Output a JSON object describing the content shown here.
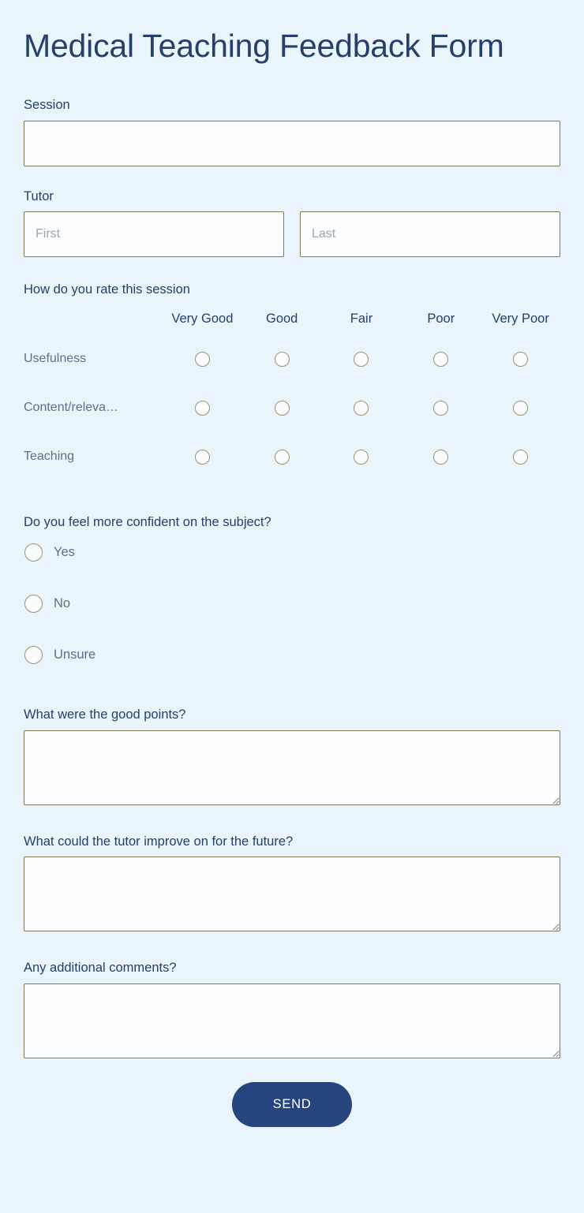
{
  "form": {
    "title": "Medical Teaching Feedback Form"
  },
  "session": {
    "label": "Session",
    "value": "",
    "placeholder": ""
  },
  "tutor": {
    "label": "Tutor",
    "first": {
      "value": "",
      "placeholder": "First"
    },
    "last": {
      "value": "",
      "placeholder": "Last"
    }
  },
  "rating": {
    "question": "How do you rate this session",
    "columns": [
      "Very Good",
      "Good",
      "Fair",
      "Poor",
      "Very Poor"
    ],
    "rows": [
      {
        "label": "Usefulness"
      },
      {
        "label": "Content/releva…"
      },
      {
        "label": "Teaching"
      }
    ]
  },
  "confidence": {
    "question": "Do you feel more confident on the subject?",
    "options": [
      {
        "label": "Yes"
      },
      {
        "label": "No"
      },
      {
        "label": "Unsure"
      }
    ]
  },
  "good_points": {
    "label": "What were the good points?",
    "value": "",
    "placeholder": ""
  },
  "improvements": {
    "label": "What could the tutor improve on for the future?",
    "value": "",
    "placeholder": ""
  },
  "additional_comments": {
    "label": "Any additional comments?",
    "value": "",
    "placeholder": ""
  },
  "submit": {
    "label": "SEND"
  },
  "colors": {
    "background": "#e9f4fb",
    "title_text": "#27406b",
    "label_text": "#27406b",
    "muted_text": "#5d7287",
    "input_border": "#7e7a55",
    "input_background": "#fbfdfe",
    "radio_border": "#9a9470",
    "button_background": "#26457e",
    "button_text": "#ffffff",
    "placeholder_text": "#9aa6b4"
  }
}
